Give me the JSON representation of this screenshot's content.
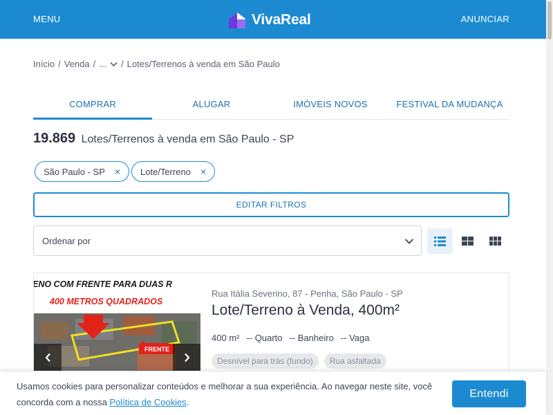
{
  "header": {
    "menu_label": "MENU",
    "logo_text": "VivaReal",
    "anunciar_label": "ANUNCIAR",
    "brand_color": "#1c8ad0"
  },
  "breadcrumb": {
    "items": [
      "Início",
      "Venda",
      "...",
      "Lotes/Terrenos à venda em São Paulo"
    ],
    "separator": "/"
  },
  "tabs": [
    {
      "label": "COMPRAR",
      "active": true
    },
    {
      "label": "ALUGAR",
      "active": false
    },
    {
      "label": "IMÓVEIS NOVOS",
      "active": false
    },
    {
      "label": "FESTIVAL DA MUDANÇA",
      "active": false
    }
  ],
  "results": {
    "count": "19.869",
    "title": "Lotes/Terrenos à venda em São Paulo - SP"
  },
  "filters": {
    "chips": [
      {
        "label": "São Paulo - SP",
        "remove_icon": "×"
      },
      {
        "label": "Lote/Terreno",
        "remove_icon": "×"
      }
    ],
    "edit_label": "EDITAR FILTROS"
  },
  "sort": {
    "placeholder": "Ordenar por",
    "icon": "chevron-down-icon"
  },
  "view_modes": [
    {
      "name": "list-view",
      "icon": "list-icon",
      "active": true
    },
    {
      "name": "grid-view",
      "icon": "grid-icon",
      "active": false
    },
    {
      "name": "mosaic-view",
      "icon": "mosaic-icon",
      "active": false
    }
  ],
  "listing": {
    "photo_text_line1": "ENO COM FRENTE PARA DUAS R",
    "photo_text_line2": "400 METROS QUADRADOS",
    "photo_tag": "FRENTE",
    "address": "Rua Itália Severino, 87 - Penha, São Paulo - SP",
    "title": "Lote/Terreno à Venda, 400m²",
    "features": {
      "area": "400",
      "area_unit": "m²",
      "rooms": "-- Quarto",
      "bathrooms": "-- Banheiro",
      "parking": "-- Vaga"
    },
    "amenities": [
      "Desnível para trás (fundo)",
      "Rua asfaltada"
    ]
  },
  "cookie_banner": {
    "message": "Usamos cookies para personalizar conteúdos e melhorar a sua experiência. Ao navegar neste site, você concorda com a nossa ",
    "link_text": "Política de Cookies",
    "message_end": ".",
    "accept_label": "Entendi"
  }
}
